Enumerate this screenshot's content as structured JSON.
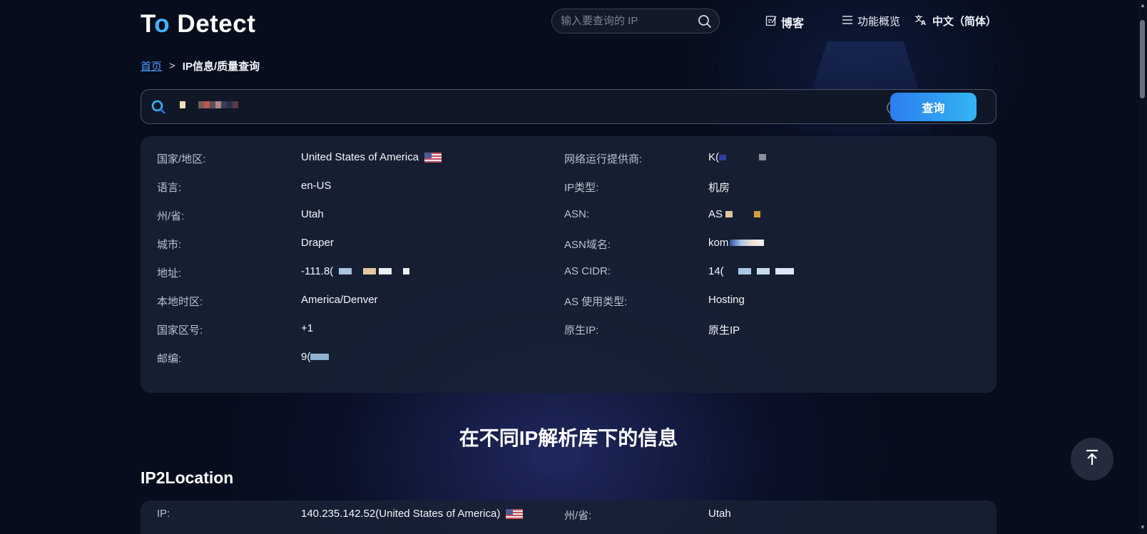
{
  "header": {
    "logo": "To Detect",
    "search_placeholder": "输入要查询的 IP",
    "nav_blog": "博客",
    "nav_features": "功能概览",
    "nav_language": "中文（简体）"
  },
  "breadcrumb": {
    "home": "首页",
    "separator": ">",
    "current": "IP信息/质量查询"
  },
  "query": {
    "button": "查询"
  },
  "info": {
    "left": [
      {
        "label": "国家/地区:",
        "value": "United States of America",
        "flag": "us-flag"
      },
      {
        "label": "语言:",
        "value": "en-US"
      },
      {
        "label": "州/省:",
        "value": "Utah"
      },
      {
        "label": "城市:",
        "value": "Draper"
      },
      {
        "label": "地址:",
        "value": "-111.8("
      },
      {
        "label": "本地时区:",
        "value": "America/Denver"
      },
      {
        "label": "国家区号:",
        "value": "+1"
      },
      {
        "label": "邮编:",
        "value": "9("
      }
    ],
    "right": [
      {
        "label": "网络运行提供商:",
        "value": "K("
      },
      {
        "label": "IP类型:",
        "value": "机房"
      },
      {
        "label": "ASN:",
        "value": "AS"
      },
      {
        "label": "ASN域名:",
        "value": "kom"
      },
      {
        "label": "AS CIDR:",
        "value": "14("
      },
      {
        "label": "AS 使用类型:",
        "value": "Hosting"
      },
      {
        "label": "原生IP:",
        "value": "原生IP"
      }
    ]
  },
  "section_title": "在不同IP解析库下的信息",
  "ip2location": {
    "title": "IP2Location",
    "ip_label": "IP:",
    "ip_value": "140.235.142.52(United States of America)",
    "state_label": "州/省:",
    "state_value": "Utah"
  },
  "colors": {
    "accent": "#2c7df0",
    "accent2": "#33b5f3",
    "link": "#4a9cff",
    "background": "#070d1d",
    "card": "#182134"
  },
  "icons": [
    "search-icon",
    "edit-icon",
    "menu-icon",
    "translate-icon",
    "clear-icon",
    "arrow-up-icon",
    "us-flag-icon"
  ]
}
